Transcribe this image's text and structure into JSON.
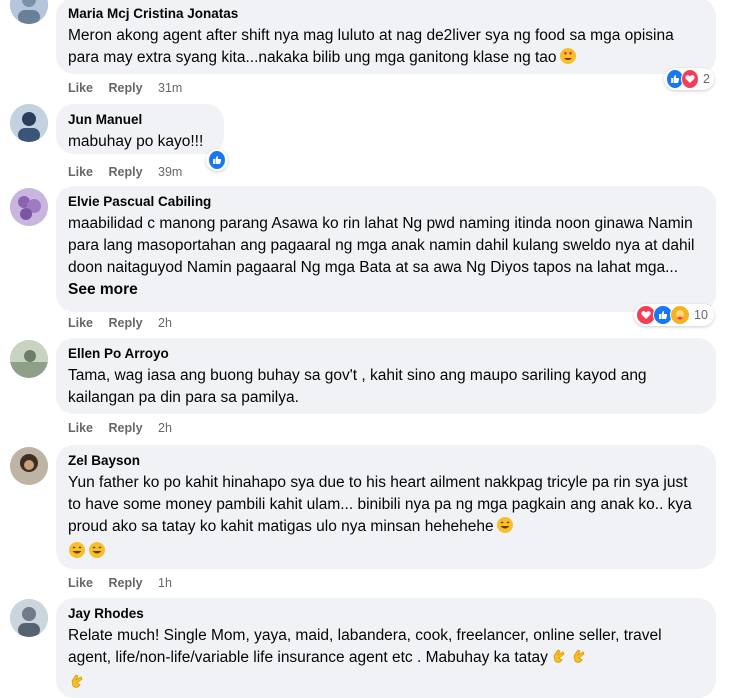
{
  "comments": [
    {
      "author": "Maria Mcj Cristina Jonatas",
      "text": "Meron akong agent after shift nya mag luluto at nag de2liver sya ng food sa mga opisina para may extra syang kita...nakaka bilib ung mga ganitong klase ng tao",
      "like": "Like",
      "reply": "Reply",
      "time": "31m",
      "reaction_count": "2",
      "reactions": [
        "like-icon",
        "love-icon"
      ],
      "avatar_color": "#8fa8c8"
    },
    {
      "author": "Jun Manuel",
      "text": "mabuhay po kayo!!!",
      "like": "Like",
      "reply": "Reply",
      "time": "39m",
      "reactions": [
        "like-icon"
      ],
      "avatar_color": "#5f7ea3"
    },
    {
      "author": "Elvie Pascual Cabiling",
      "text": "maabilidad c manong parang Asawa ko rin lahat Ng pwd naming itinda noon ginawa Namin para lang masoportahan ang pagaaral ng mga anak namin dahil kulang sweldo nya at dahil doon naitaguyod Namin pagaaral Ng mga Bata at sa awa Ng Diyos tapos na lahat mga...",
      "see_more": "See more",
      "like": "Like",
      "reply": "Reply",
      "time": "2h",
      "reaction_count": "10",
      "reactions": [
        "love-icon",
        "like-icon",
        "care-icon"
      ],
      "avatar_color": "#9b7fb8"
    },
    {
      "author": "Ellen Po Arroyo",
      "text": "Tama, wag iasa ang buong buhay sa gov't , kahit sino ang maupo sariling kayod ang kailangan pa din para sa pamilya.",
      "like": "Like",
      "reply": "Reply",
      "time": "2h",
      "avatar_color": "#a7b4a0"
    },
    {
      "author": "Zel Bayson",
      "text": "Yun father ko po kahit hinahapo sya due to his heart ailment nakkpag tricyle pa rin sya just to have some money pambili kahit ulam... binibili nya pa ng mga pagkain ang anak ko.. kya proud ako sa tatay ko kahit matigas ulo nya minsan hehehehe",
      "like": "Like",
      "reply": "Reply",
      "time": "1h",
      "avatar_color": "#5a4a3a"
    },
    {
      "author": "Jay Rhodes",
      "text": "Relate much! Single Mom, yaya, maid, labandera, cook, freelancer, online seller, travel agent, life/non-life/variable life insurance agent etc . Mabuhay ka tatay",
      "avatar_color": "#8a9aa8"
    }
  ],
  "colors": {
    "bubble": "#f0f2f5",
    "secondary_text": "#65676b",
    "like_blue": "#1877f2",
    "love_red": "#f33e58"
  }
}
